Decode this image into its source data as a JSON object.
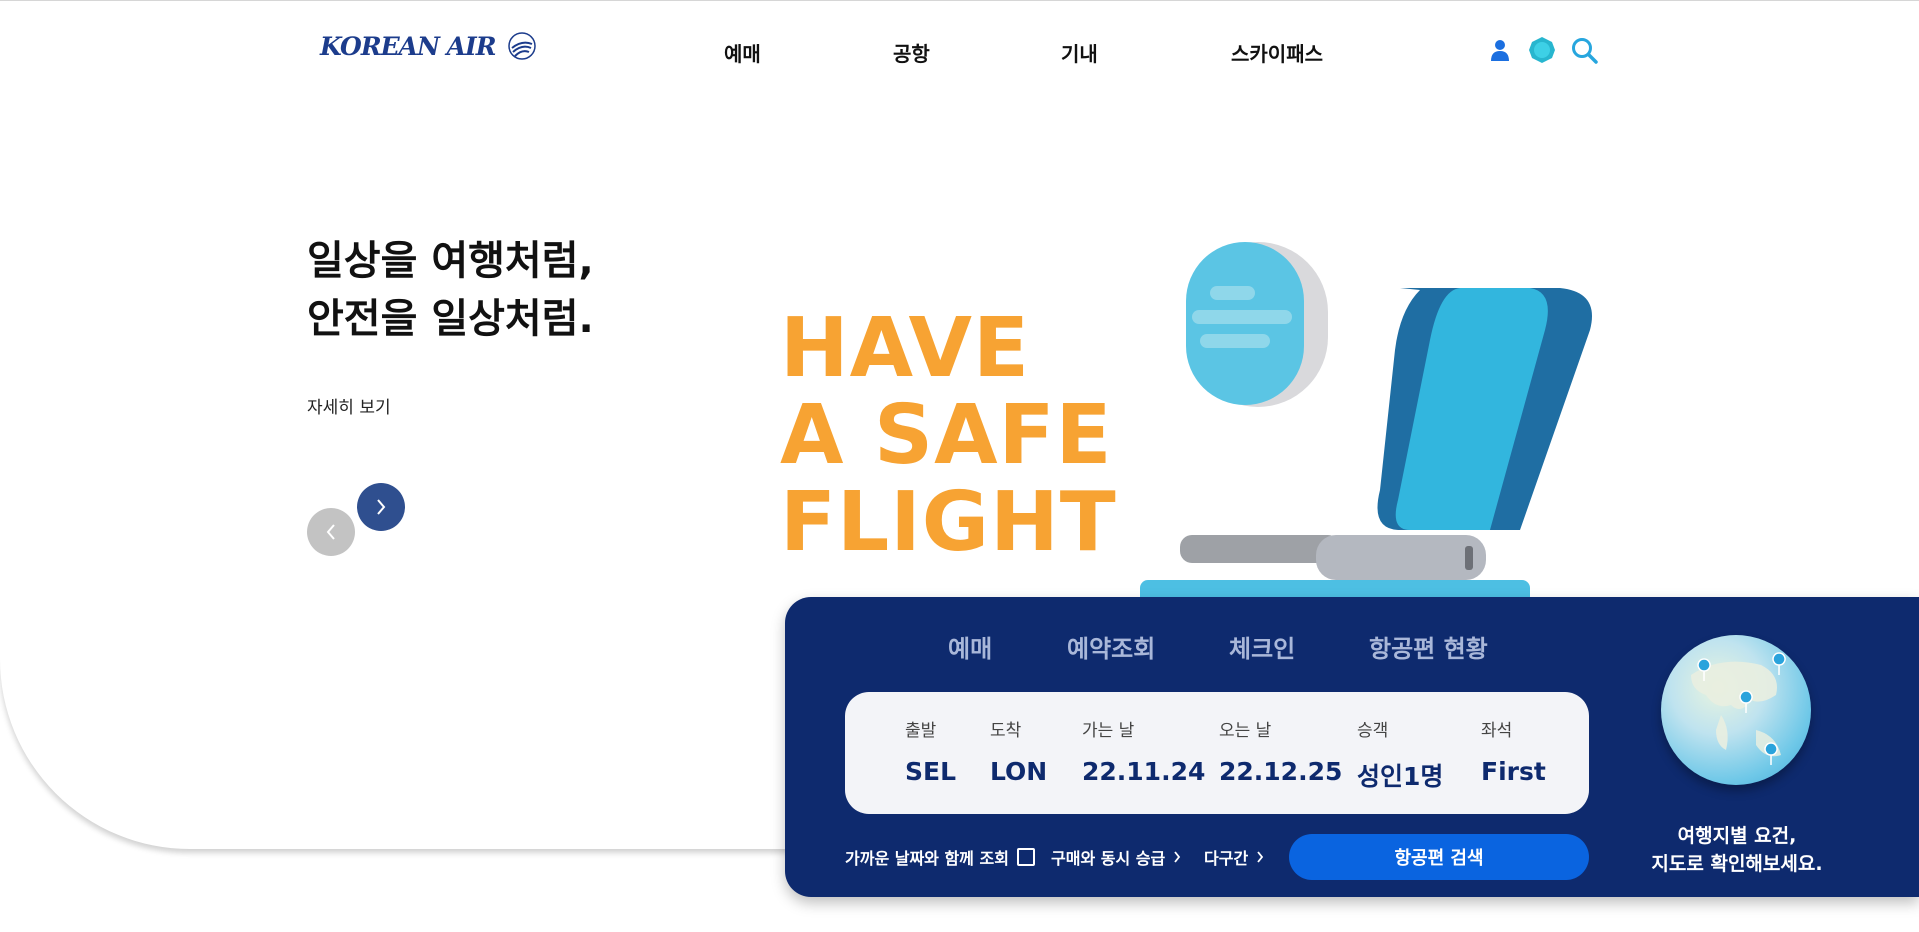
{
  "header": {
    "logo_text": "KOREAN AIR",
    "nav": [
      "예매",
      "공항",
      "기내",
      "스카이패스"
    ],
    "icons": [
      "user-icon",
      "globe-icon",
      "search-icon"
    ]
  },
  "hero": {
    "headline_line1": "일상을 여행처럼,",
    "headline_line2": "안전을 일상처럼.",
    "more_link": "자세히 보기",
    "slogan": [
      "HAVE",
      "A SAFE",
      "FLIGHT"
    ]
  },
  "booking": {
    "tabs": [
      "예매",
      "예약조회",
      "체크인",
      "항공편 현황"
    ],
    "fields": [
      {
        "label": "출발",
        "value": "SEL"
      },
      {
        "label": "도착",
        "value": "LON"
      },
      {
        "label": "가는 날",
        "value": "22.11.24"
      },
      {
        "label": "오는 날",
        "value": "22.12.25"
      },
      {
        "label": "승객",
        "value": "성인1명"
      },
      {
        "label": "좌석",
        "value": "First"
      }
    ],
    "options": {
      "nearby_dates": "가까운 날짜와 함께 조회",
      "upgrade": "구매와 동시 승급",
      "multi_city": "다구간"
    },
    "search_button": "항공편 검색",
    "map_text_line1": "여행지별 요건,",
    "map_text_line2": "지도로 확인해보세요."
  },
  "colors": {
    "brand_navy": "#0e2a6e",
    "accent_orange": "#f7a333",
    "primary_blue": "#0a64e0"
  }
}
